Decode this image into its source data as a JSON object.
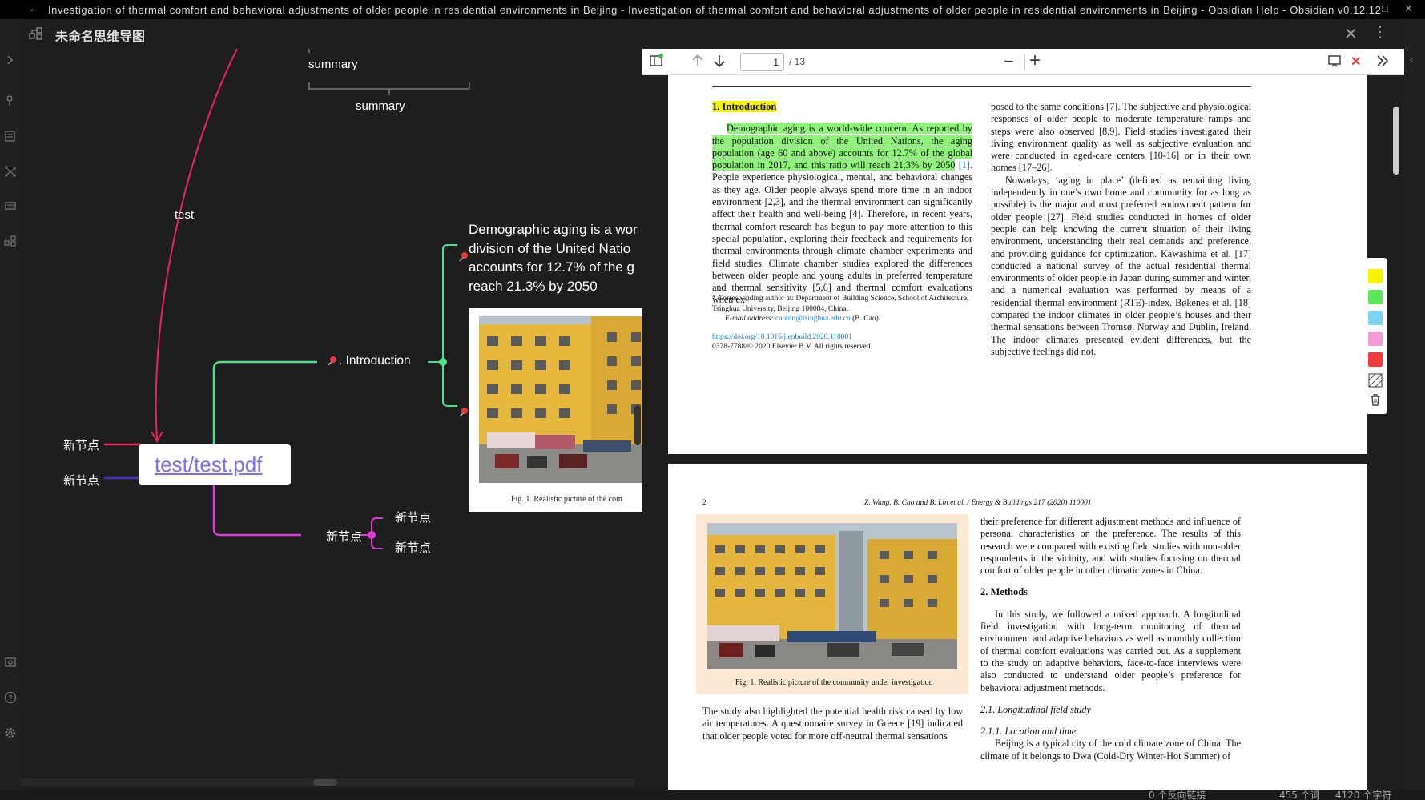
{
  "window": {
    "title": "Investigation of thermal comfort and behavioral adjustments of older people in residential environments in Beijing - Investigation of thermal comfort and behavioral adjustments of older people in residential environments in Beijing - Obsidian Help - Obsidian v0.12.12",
    "back_icon": "back-arrow-icon",
    "maximize_icon": "maximize-icon",
    "close_icon": "close-icon"
  },
  "view": {
    "title": "未命名思维导图",
    "icon": "mindmap-icon",
    "close_icon": "close-icon",
    "more_icon": "more-options-icon"
  },
  "ribbon": {
    "icons": [
      "expand-sidebar-icon",
      "search-icon",
      "files-icon",
      "graph-icon",
      "slides-icon",
      "mindmap-icon",
      "vault-icon",
      "help-icon",
      "settings-icon"
    ]
  },
  "mindmap": {
    "summary_top": "summary",
    "summary_bottom": "summary",
    "edge_label": "test",
    "root_link": "test/test.pdf",
    "node_introduction": ". Introduction",
    "node_left_1": "新节点",
    "node_left_2": "新节点",
    "node_bottom": "新节点",
    "node_bottom_child_1": "新节点",
    "node_bottom_child_2": "新节点",
    "demographic_text": [
      "Demographic aging is a wor",
      "division of the United Natio",
      "accounts for 12.7% of the g",
      "reach 21.3% by 2050"
    ],
    "image_caption": "Fig. 1.  Realistic picture of the com",
    "colors": {
      "green": "#4ddf8a",
      "magenta": "#e03ad6",
      "red": "#e8245a",
      "purple": "#4a2cc9"
    }
  },
  "pdf": {
    "toolbar": {
      "sidebar_icon": "sidebar-toggle-icon",
      "prev_icon": "arrow-up-icon",
      "next_icon": "arrow-down-icon",
      "page_value": "1",
      "page_count": "/ 13",
      "zoom_out": "−",
      "zoom_in": "+",
      "presentation_icon": "presentation-icon",
      "close_label": "✕",
      "tools_icon": "double-chevron-icon"
    },
    "page1": {
      "heading": "1.  Introduction",
      "para1_hl": "Demographic aging is a world-wide concern. As reported by the population division of the United Nations, the aging population (age 60 and above) accounts for 12.7% of the global population in 2017, and this ratio will reach 21.3% by 2050",
      "para1_ref": "[1]",
      "para1_rest": ". People experience physiological, mental, and behavioral changes as they age. Older people always spend more time in an indoor environment [2,3], and the thermal environment can significantly affect their health and well-being [4]. Therefore, in recent years, thermal comfort research has begun to pay more attention to this special population, exploring their feedback and requirements for thermal environments through climate chamber experiments and field studies. Climate chamber studies explored the differences between older people and young adults in preferred temperature and thermal sensitivity [5,6] and thermal comfort evaluations when ex-",
      "footnote_1": "* Corresponding author at: Department of Building Science, School of Architecture, Tsinghua University, Beijing 100084, China.",
      "footnote_2_label": "E-mail address:",
      "footnote_2_email": "caobin@tsinghua.edu.cn",
      "footnote_2_rest": "(B. Cao).",
      "doi": "https://doi.org/10.1016/j.enbuild.2020.110001",
      "issn": "0378-7788/© 2020 Elsevier B.V. All rights reserved.",
      "right_col_1": "posed to the same conditions [7]. The subjective and physiological responses of older people to moderate temperature ramps and steps were also observed [8,9]. Field studies investigated their living environment quality as well as subjective evaluation and were conducted in aged-care centers [10-16] or in their own homes [17–26].",
      "right_col_2": "Nowadays, ‘aging in place’ (defined as remaining living independently in one’s own home and community for as long as possible) is the major and most preferred endowment pattern for older people [27]. Field studies conducted in homes of older people can help knowing the current situation of their living environment, understanding their real demands and preference, and providing guidance for optimization. Kawashima et al. [17] conducted a national survey of the actual residential thermal environments of older people in Japan during summer and winter, and a numerical evaluation was performed by means of a residential thermal environment (RTE)-index. Bøkenes et al. [18] compared the indoor climates in older people’s houses and their thermal sensations between Tromsø, Norway and Dublin, Ireland. The indoor climates presented evident differences, but the subjective feelings did not."
    },
    "page2": {
      "page_number": "2",
      "running_head": "Z. Wang, B. Cao and B. Lin et al. / Energy & Buildings 217 (2020) 110001",
      "figure_caption": "Fig. 1.  Realistic picture of the community under investigation",
      "left_bottom": "The study also highlighted the potential health risk caused by low air temperatures. A questionnaire survey in Greece [19] indicated that older people voted for more off-neutral thermal sensations",
      "right_1": "their preference for different adjustment methods and influence of personal characteristics on the preference. The results of this research were compared with existing field studies with non-older respondents in the vicinity, and with studies focusing on thermal comfort of older people in other climatic zones in China.",
      "methods_heading": "2.  Methods",
      "methods_text": "In this study, we followed a mixed approach. A longitudinal field investigation with long-term monitoring of thermal environment and adaptive behaviors as well as monthly collection of thermal comfort evaluations was carried out. As a supplement to the study on adaptive behaviors, face-to-face interviews were also conducted to understand older people’s preference for behavioral adjustment methods.",
      "sub_heading_1": "2.1.  Longitudinal field study",
      "sub_heading_2": "2.1.1.  Location and time",
      "location_text": "Beijing is a typical city of the cold climate zone of China. The climate of it belongs to Dwa (Cold-Dry Winter-Hot Summer) of"
    },
    "palette": {
      "colors": [
        "#f7f400",
        "#5ce65c",
        "#7dd3f0",
        "#f59ad9",
        "#f03c3c"
      ],
      "pattern_icon": "hatch-pattern-icon",
      "delete_icon": "trash-icon"
    }
  },
  "statusbar": {
    "backlinks": "0 个反向链接",
    "words": "455 个词",
    "chars": "4120 个字符"
  }
}
